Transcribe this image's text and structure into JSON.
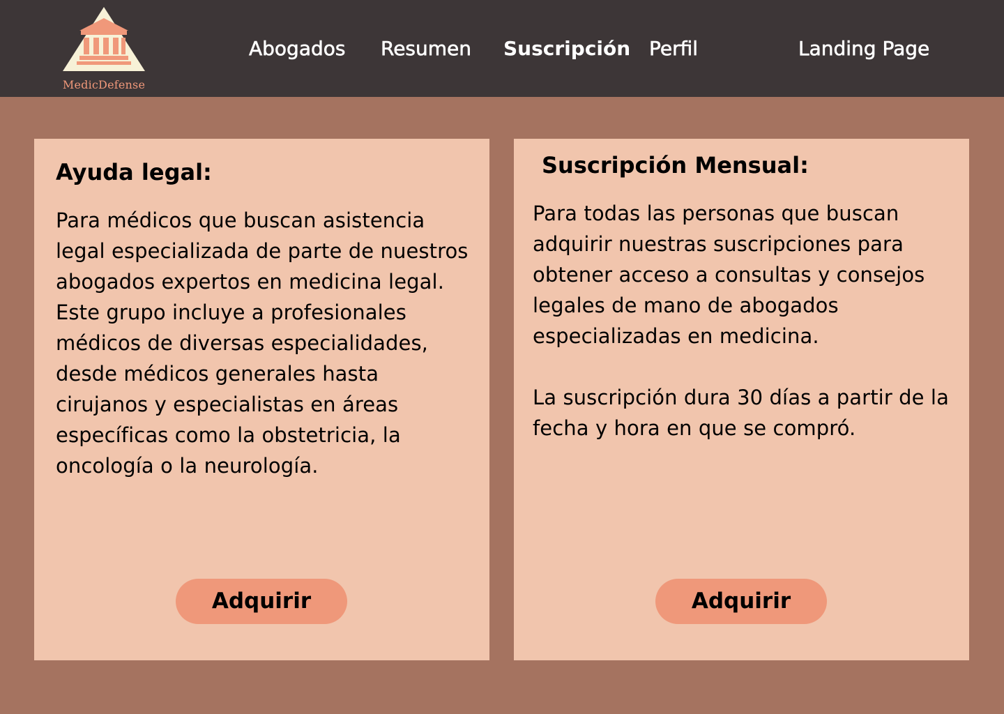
{
  "brand": {
    "name": "MedicDefense",
    "logo_icon": "courthouse-icon",
    "accent_color": "#f0987a",
    "logo_triangle_color": "#f7f1d7"
  },
  "nav": {
    "items": [
      {
        "label": "Abogados"
      },
      {
        "label": "Resumen"
      },
      {
        "label": "Suscripción",
        "active": true
      },
      {
        "label": "Perfil"
      },
      {
        "label": "Landing Page"
      }
    ]
  },
  "cards": [
    {
      "title": "Ayuda legal:",
      "body": "Para médicos que buscan asistencia legal especializada de parte de nuestros abogados expertos en medicina legal. Este grupo incluye a profesionales médicos de diversas especialidades, desde médicos generales hasta cirujanos y especialistas en áreas específicas como la obstetricia, la oncología o la neurología.",
      "button_label": "Adquirir"
    },
    {
      "title": "Suscripción Mensual:",
      "body_paragraphs": [
        "Para todas las personas que buscan adquirir nuestras suscripciones para obtener acceso a consultas y consejos legales de mano de abogados especializadas en medicina.",
        "La suscripción dura 30 días a partir de la fecha y hora en que se compró."
      ],
      "button_label": "Adquirir"
    }
  ],
  "colors": {
    "header_bg": "#3d3637",
    "page_bg": "#a57360",
    "card_bg": "#f1c5ad",
    "button_bg": "#ef987a"
  }
}
